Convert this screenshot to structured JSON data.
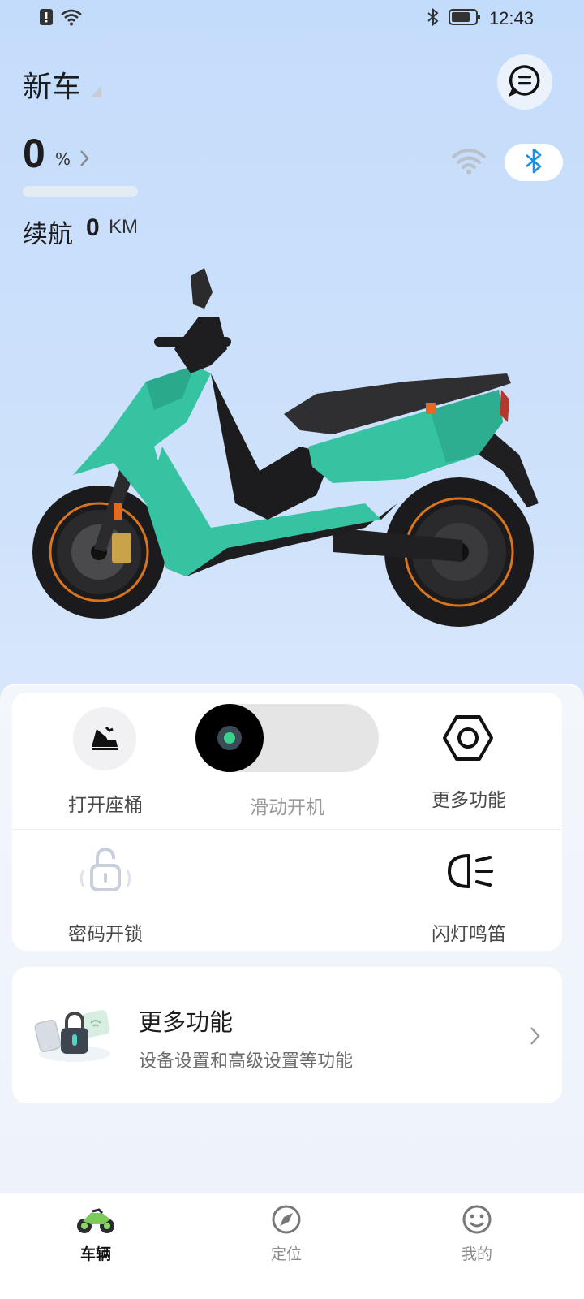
{
  "status_bar": {
    "time": "12:43",
    "icons": [
      "alert-icon",
      "wifi-icon",
      "bluetooth-icon",
      "battery-icon"
    ]
  },
  "header": {
    "vehicle_name": "新车"
  },
  "battery": {
    "value": "0",
    "unit": "%",
    "level_fraction": 0
  },
  "range": {
    "label": "续航",
    "value": "0",
    "unit": "KM"
  },
  "colors": {
    "accent_blue": "#1a8fe3",
    "accent_green": "#38d38a",
    "scooter_teal": "#35c3a2"
  },
  "controls": {
    "open_seat": "打开座桶",
    "slide_to_start": "滑动开机",
    "more_functions": "更多功能",
    "password_unlock": "密码开锁",
    "flash_horn": "闪灯鸣笛"
  },
  "more_card": {
    "title": "更多功能",
    "subtitle": "设备设置和高级设置等功能"
  },
  "bottom_nav": {
    "items": [
      {
        "label": "车辆",
        "icon": "motorcycle-icon",
        "active": true
      },
      {
        "label": "定位",
        "icon": "compass-icon",
        "active": false
      },
      {
        "label": "我的",
        "icon": "smiley-icon",
        "active": false
      }
    ]
  }
}
